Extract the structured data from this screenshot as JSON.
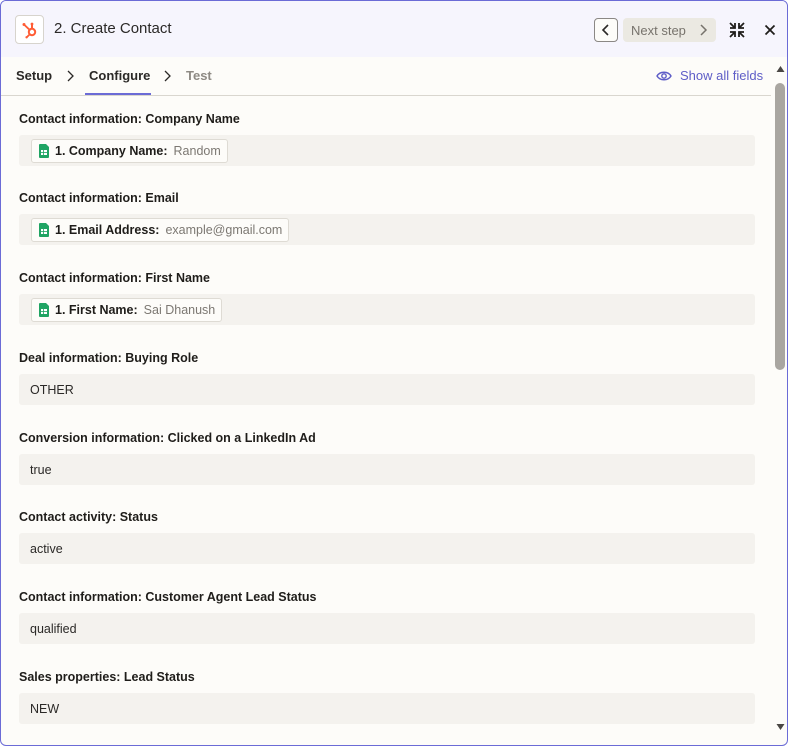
{
  "header": {
    "title": "2. Create Contact",
    "next_label": "Next step",
    "app_icon": "hubspot-icon"
  },
  "tabs": [
    {
      "label": "Setup"
    },
    {
      "label": "Configure"
    },
    {
      "label": "Test"
    }
  ],
  "show_all_fields_label": "Show all fields",
  "fields": [
    {
      "label": "Contact information: Company Name",
      "pill_key": "1. Company Name:",
      "pill_value": "Random"
    },
    {
      "label": "Contact information: Email",
      "pill_key": "1. Email Address:",
      "pill_value": "example@gmail.com"
    },
    {
      "label": "Contact information: First Name",
      "pill_key": "1. First Name:",
      "pill_value": "Sai Dhanush"
    },
    {
      "label": "Deal information: Buying Role",
      "value": "OTHER"
    },
    {
      "label": "Conversion information: Clicked on a LinkedIn Ad",
      "value": "true"
    },
    {
      "label": "Contact activity: Status",
      "value": "active"
    },
    {
      "label": "Contact information: Customer Agent Lead Status",
      "value": "qualified"
    },
    {
      "label": "Sales properties: Lead Status",
      "value": "NEW"
    }
  ],
  "colors": {
    "accent": "#6b6bd6",
    "hubspot_orange": "#ff5c35",
    "sheets_green": "#1fa463"
  }
}
